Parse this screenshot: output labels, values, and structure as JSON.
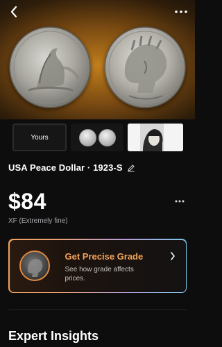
{
  "header": {
    "back_icon": "chevron-left-icon",
    "more_icon": "more-horizontal-icon"
  },
  "thumbnails": {
    "yours_label": "Yours"
  },
  "coin": {
    "title": "USA Peace Dollar · 1923-S",
    "edit_icon": "pencil-icon",
    "price": "$84",
    "grade": "XF (Extremely fine)"
  },
  "grade_card": {
    "title": "Get Precise Grade",
    "subtitle": "See how grade affects prices.",
    "chevron_icon": "chevron-right-icon"
  },
  "section": {
    "title": "Expert Insights"
  },
  "colors": {
    "accent": "#f5a356",
    "background": "#0d0d0e"
  }
}
